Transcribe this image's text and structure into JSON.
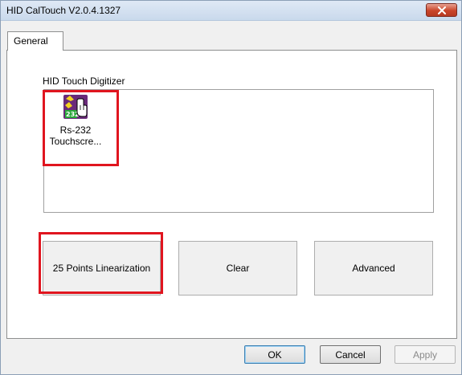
{
  "window": {
    "title": "HID CalTouch V2.0.4.1327",
    "close_icon": "close-x-icon"
  },
  "tabs": [
    {
      "label": "General",
      "selected": true
    }
  ],
  "digitizer": {
    "group_label": "HID Touch Digitizer",
    "devices": [
      {
        "label_line1": "Rs-232",
        "label_line2": "Touchscre...",
        "icon": "touch-device-icon"
      }
    ]
  },
  "actions": {
    "linearization_label": "25 Points Linearization",
    "clear_label": "Clear",
    "advanced_label": "Advanced"
  },
  "footer": {
    "ok_label": "OK",
    "cancel_label": "Cancel",
    "apply_label": "Apply"
  },
  "colors": {
    "highlight": "#e0151f",
    "close_button": "#c9452a"
  }
}
